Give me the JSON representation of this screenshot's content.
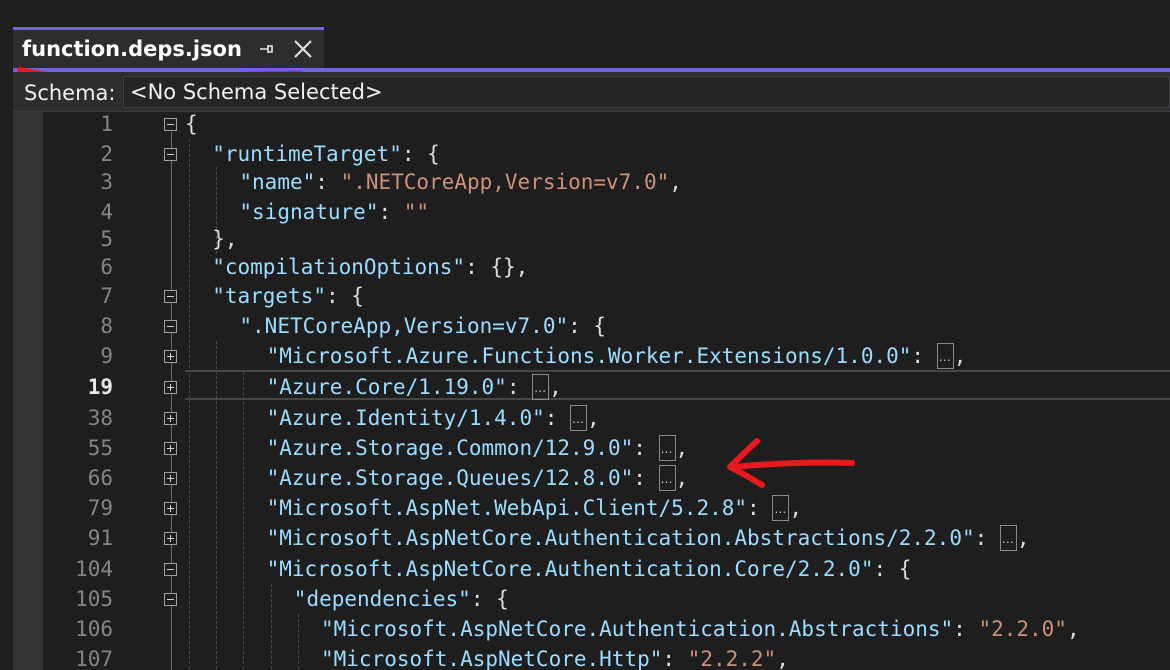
{
  "tab": {
    "title": "function.deps.json",
    "accent_color": "#7160e8",
    "icons": [
      "pin-icon",
      "close-icon"
    ]
  },
  "schema_bar": {
    "label": "Schema:",
    "selected": "<No Schema Selected>"
  },
  "editor": {
    "current_line": "19",
    "lines": [
      {
        "num": "1",
        "fold": "minus",
        "tokens": [
          [
            "p",
            "{"
          ]
        ]
      },
      {
        "num": "2",
        "fold": "minus",
        "tokens": [
          [
            "k",
            "\"runtimeTarget\""
          ],
          [
            "p",
            ": {"
          ]
        ]
      },
      {
        "num": "3",
        "fold": "",
        "tokens": [
          [
            "k",
            "\"name\""
          ],
          [
            "p",
            ": "
          ],
          [
            "s",
            "\".NETCoreApp,Version=v7.0\""
          ],
          [
            "p",
            ","
          ]
        ]
      },
      {
        "num": "4",
        "fold": "",
        "tokens": [
          [
            "k",
            "\"signature\""
          ],
          [
            "p",
            ": "
          ],
          [
            "s",
            "\"\""
          ]
        ]
      },
      {
        "num": "5",
        "fold": "",
        "tokens": [
          [
            "p",
            "},"
          ]
        ]
      },
      {
        "num": "6",
        "fold": "",
        "tokens": [
          [
            "k",
            "\"compilationOptions\""
          ],
          [
            "p",
            ": {},"
          ]
        ]
      },
      {
        "num": "7",
        "fold": "minus",
        "tokens": [
          [
            "k",
            "\"targets\""
          ],
          [
            "p",
            ": {"
          ]
        ]
      },
      {
        "num": "8",
        "fold": "minus",
        "tokens": [
          [
            "k",
            "\".NETCoreApp,Version=v7.0\""
          ],
          [
            "p",
            ": {"
          ]
        ]
      },
      {
        "num": "9",
        "fold": "plus",
        "tokens": [
          [
            "k",
            "\"Microsoft.Azure.Functions.Worker.Extensions/1.0.0\""
          ],
          [
            "p",
            ": "
          ],
          [
            "c",
            ""
          ],
          [
            "p",
            ","
          ]
        ]
      },
      {
        "num": "19",
        "fold": "plus",
        "tokens": [
          [
            "k",
            "\"Azure.Core/1.19.0\""
          ],
          [
            "p",
            ": "
          ],
          [
            "c",
            ""
          ],
          [
            "p",
            ","
          ]
        ]
      },
      {
        "num": "38",
        "fold": "plus",
        "tokens": [
          [
            "k",
            "\"Azure.Identity/1.4.0\""
          ],
          [
            "p",
            ": "
          ],
          [
            "c",
            ""
          ],
          [
            "p",
            ","
          ]
        ]
      },
      {
        "num": "55",
        "fold": "plus",
        "tokens": [
          [
            "k",
            "\"Azure.Storage.Common/12.9.0\""
          ],
          [
            "p",
            ": "
          ],
          [
            "c",
            ""
          ],
          [
            "p",
            ","
          ]
        ]
      },
      {
        "num": "66",
        "fold": "plus",
        "tokens": [
          [
            "k",
            "\"Azure.Storage.Queues/12.8.0\""
          ],
          [
            "p",
            ": "
          ],
          [
            "c",
            ""
          ],
          [
            "p",
            ","
          ]
        ]
      },
      {
        "num": "79",
        "fold": "plus",
        "tokens": [
          [
            "k",
            "\"Microsoft.AspNet.WebApi.Client/5.2.8\""
          ],
          [
            "p",
            ": "
          ],
          [
            "c",
            ""
          ],
          [
            "p",
            ","
          ]
        ]
      },
      {
        "num": "91",
        "fold": "plus",
        "tokens": [
          [
            "k",
            "\"Microsoft.AspNetCore.Authentication.Abstractions/2.2.0\""
          ],
          [
            "p",
            ": "
          ],
          [
            "c",
            ""
          ],
          [
            "p",
            ","
          ]
        ]
      },
      {
        "num": "104",
        "fold": "minus",
        "tokens": [
          [
            "k",
            "\"Microsoft.AspNetCore.Authentication.Core/2.2.0\""
          ],
          [
            "p",
            ": {"
          ]
        ]
      },
      {
        "num": "105",
        "fold": "minus",
        "tokens": [
          [
            "k",
            "\"dependencies\""
          ],
          [
            "p",
            ": {"
          ]
        ]
      },
      {
        "num": "106",
        "fold": "",
        "tokens": [
          [
            "k",
            "\"Microsoft.AspNetCore.Authentication.Abstractions\""
          ],
          [
            "p",
            ": "
          ],
          [
            "s",
            "\"2.2.0\""
          ],
          [
            "p",
            ","
          ]
        ]
      },
      {
        "num": "107",
        "fold": "",
        "tokens": [
          [
            "k",
            "\"Microsoft.AspNetCore.Http\""
          ],
          [
            "p",
            ": "
          ],
          [
            "s",
            "\"2.2.2\""
          ],
          [
            "p",
            ","
          ]
        ]
      }
    ],
    "colors": {
      "background": "#1e1e1e",
      "property": "#9cdcfe",
      "string": "#ce9178",
      "punctuation": "#dcdcdc",
      "line_number": "#858585"
    }
  }
}
